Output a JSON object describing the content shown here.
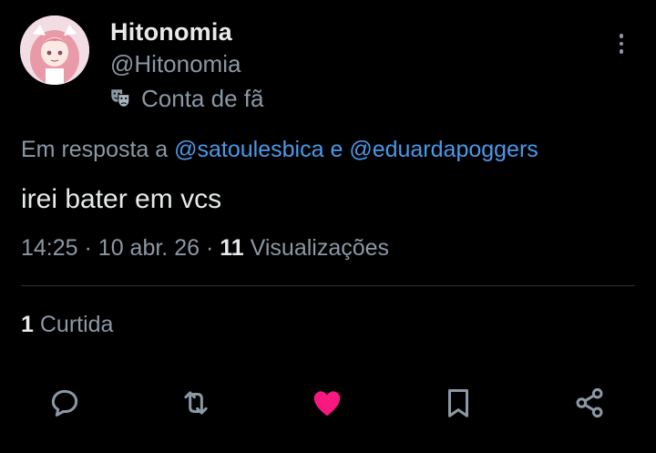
{
  "author": {
    "display_name": "Hitonomia",
    "handle": "@Hitonomia",
    "label_icon": "theater-masks-icon",
    "label_text": "Conta de fã"
  },
  "reply_context": {
    "prefix": "Em resposta a",
    "mention_1": "@satoulesbica",
    "conjunction": "e",
    "mention_2": "@eduardapoggers"
  },
  "tweet": {
    "text": "irei bater em vcs"
  },
  "meta": {
    "time": "14:25",
    "separator": "·",
    "date": "10 abr. 26",
    "views_count": "11",
    "views_label": "Visualizações"
  },
  "engagement": {
    "likes_count": "1",
    "likes_label": "Curtida"
  },
  "actions": [
    {
      "name": "reply-icon"
    },
    {
      "name": "retweet-icon"
    },
    {
      "name": "like-icon",
      "active": true
    },
    {
      "name": "bookmark-icon"
    },
    {
      "name": "share-icon"
    }
  ],
  "colors": {
    "background": "#000000",
    "primary_text": "#e7e9ea",
    "secondary_text": "#8b98a5",
    "mention": "#4a99e9",
    "like_active": "#f91880",
    "divider": "#2f3336"
  }
}
